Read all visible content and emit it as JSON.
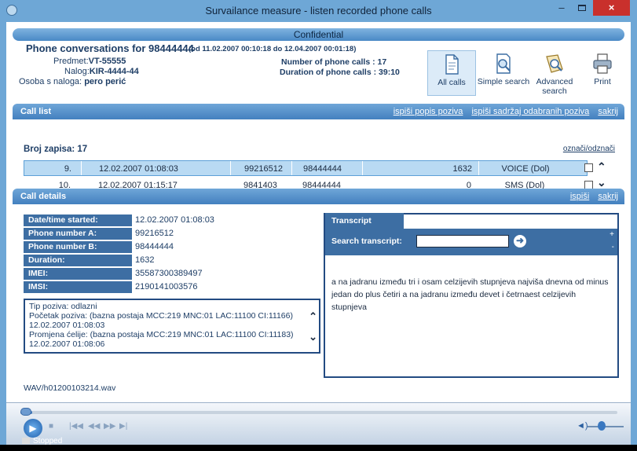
{
  "window": {
    "title": "Survailance measure - listen recorded phone calls",
    "close_label": "×",
    "min_label": "–"
  },
  "banner": "Confidential",
  "header": {
    "title_prefix": "Phone conversations for",
    "number": "98444444",
    "range": "(od 11.02.2007 00:10:18 do 12.04.2007 00:01:18)",
    "predmet_label": "Predmet:",
    "predmet_value": "VT-55555",
    "nalog_label": "Nalog:",
    "nalog_value": "KIR-4444-44",
    "osoba_label": "Osoba s naloga:",
    "osoba_value": "pero perić",
    "calls_label": "Number of phone calls :",
    "calls_value": "17",
    "duration_label": "Duration of phone calls :",
    "duration_value": "39:10"
  },
  "toolbar": {
    "all_calls": "All calls",
    "simple_search": "Simple search",
    "advanced_search": "Advanced search",
    "print": "Print"
  },
  "call_list": {
    "title": "Call list",
    "links": [
      "ispiši popis poziva",
      "ispiši sadržaj odabranih poziva",
      "sakrij"
    ],
    "count_label": "Broj zapisa:",
    "count": "17",
    "select_links": "označi/odznači",
    "rows": [
      {
        "n": "9.",
        "datetime": "12.02.2007 01:08:03",
        "a": "99216512",
        "b": "98444444",
        "duration": "1632",
        "type": "VOICE (Dol)"
      },
      {
        "n": "10.",
        "datetime": "12.02.2007 01:15:17",
        "a": "9841403",
        "b": "98444444",
        "duration": "0",
        "type": "SMS (Dol)"
      }
    ]
  },
  "call_details": {
    "title": "Call details",
    "links": [
      "ispiši",
      "sakrij"
    ],
    "fields": [
      {
        "label": "Date/time started:",
        "value": "12.02.2007 01:08:03"
      },
      {
        "label": "Phone number A:",
        "value": "99216512"
      },
      {
        "label": "Phone number B:",
        "value": "98444444"
      },
      {
        "label": "Duration:",
        "value": "1632"
      },
      {
        "label": "IMEI:",
        "value": "35587300389497"
      },
      {
        "label": "IMSI:",
        "value": "2190141003576"
      }
    ],
    "events": [
      "Tip poziva: odlazni",
      "Početak poziva: (bazna postaja MCC:219 MNC:01 LAC:11100 CI:11166)",
      "12.02.2007 01:08:03",
      "Promjena ćelije: (bazna postaja MCC:219 MNC:01 LAC:11100 CI:11183)",
      "12.02.2007 01:08:06"
    ],
    "file": "WAV/h01200103214.wav"
  },
  "transcript": {
    "tab": "Transcript",
    "search_label": "Search transcript:",
    "search_value": "",
    "text": "a na jadranu između tri i osam celzijevih stupnjeva najviša dnevna od minus jedan do plus četiri a na jadranu između devet i četrnaest celzijevih stupnjeva"
  },
  "player": {
    "status": "Stopped",
    "progress": 0.02,
    "volume": 0.4
  }
}
